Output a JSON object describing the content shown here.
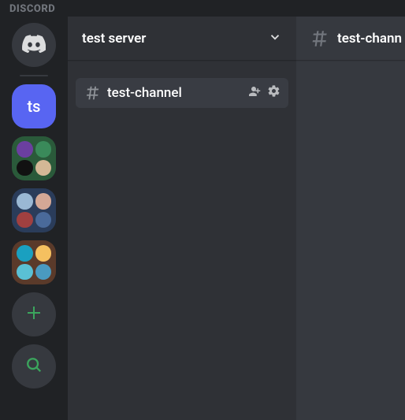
{
  "app": {
    "brand": "DISCORD"
  },
  "rail": {
    "home_label": "discord-home",
    "selected_server_initials": "ts",
    "folders": [
      {
        "name": "folder-1",
        "bg": "green",
        "icons": [
          "#6b3fa0",
          "#3a8a5a",
          "#111",
          "#d4b896"
        ]
      },
      {
        "name": "folder-2",
        "bg": "blue",
        "icons": [
          "#9ab8d4",
          "#d4a896",
          "#a04040",
          "#4a6a9a"
        ]
      },
      {
        "name": "folder-3",
        "bg": "brown",
        "icons": [
          "#1aa0c0",
          "#f5c060",
          "#5ac0d4",
          "#4a9ac0"
        ]
      }
    ]
  },
  "server": {
    "name": "test server",
    "channels": [
      {
        "name": "test-channel",
        "selected": true
      }
    ]
  },
  "chat": {
    "channel_name": "test-chann"
  }
}
